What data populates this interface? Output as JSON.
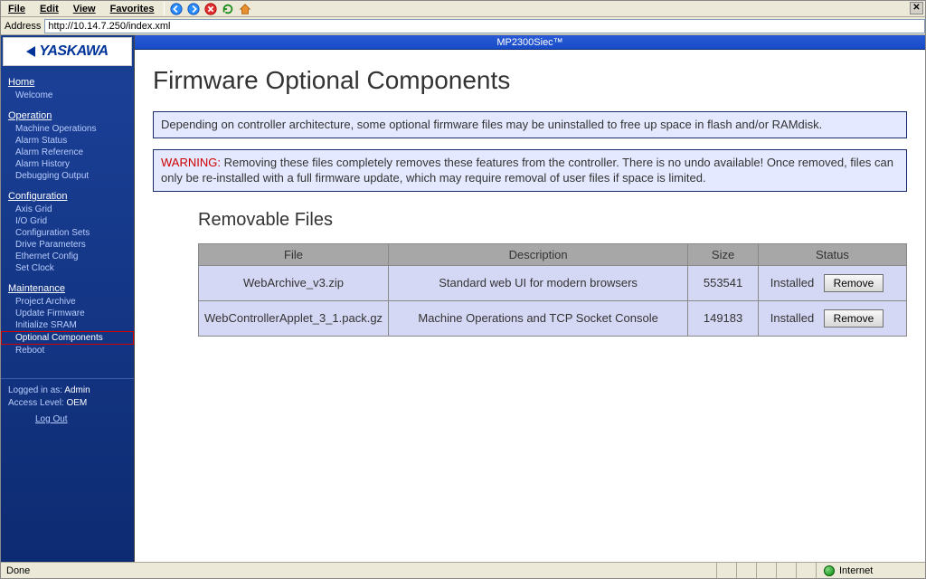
{
  "menu": {
    "file": "File",
    "edit": "Edit",
    "view": "View",
    "favorites": "Favorites"
  },
  "icons": {
    "back": "back-icon",
    "forward": "forward-icon",
    "stop": "stop-icon",
    "refresh": "refresh-icon",
    "home": "home-icon"
  },
  "addressbar": {
    "label": "Address",
    "url": "http://10.14.7.250/index.xml"
  },
  "logo": {
    "text": "YASKAWA"
  },
  "app_title": "MP2300Siec™",
  "nav": {
    "groups": [
      {
        "title": "Home",
        "items": [
          "Welcome"
        ]
      },
      {
        "title": "Operation",
        "items": [
          "Machine Operations",
          "Alarm Status",
          "Alarm Reference",
          "Alarm History",
          "Debugging Output"
        ]
      },
      {
        "title": "Configuration",
        "items": [
          "Axis Grid",
          "I/O Grid",
          "Configuration Sets",
          "Drive Parameters",
          "Ethernet Config",
          "Set Clock"
        ]
      },
      {
        "title": "Maintenance",
        "items": [
          "Project Archive",
          "Update Firmware",
          "Initialize SRAM",
          "Optional Components",
          "Reboot"
        ]
      }
    ],
    "highlighted": "Optional Components"
  },
  "login": {
    "logged_in_label": "Logged in as:",
    "user": "Admin",
    "access_label": "Access Level:",
    "level": "OEM",
    "logout": "Log Out"
  },
  "page": {
    "heading": "Firmware Optional Components",
    "note": "Depending on controller architecture, some optional firmware files may be uninstalled to free up space in flash and/or RAMdisk.",
    "warn_label": "WARNING:",
    "warn_text": " Removing these files completely removes these features from the controller. There is no undo available! Once removed, files can only be re-installed with a full firmware update, which may require removal of user files if space is limited.",
    "section": "Removable Files"
  },
  "table": {
    "headers": {
      "file": "File",
      "desc": "Description",
      "size": "Size",
      "status": "Status"
    },
    "remove_label": "Remove",
    "rows": [
      {
        "file": "WebArchive_v3.zip",
        "desc": "Standard web UI for modern browsers",
        "size": "553541",
        "status": "Installed"
      },
      {
        "file": "WebControllerApplet_3_1.pack.gz",
        "desc": "Machine Operations and TCP Socket Console",
        "size": "149183",
        "status": "Installed"
      }
    ]
  },
  "statusbar": {
    "left": "Done",
    "internet": "Internet"
  }
}
